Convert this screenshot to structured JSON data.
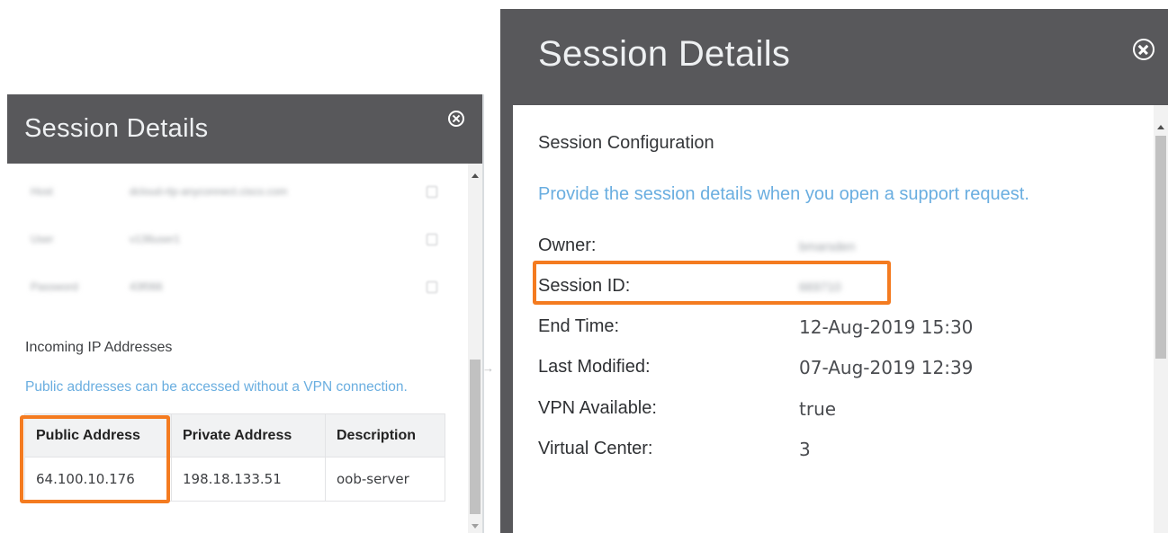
{
  "left_panel": {
    "title": "Session Details",
    "credentials": [
      {
        "label": "Host",
        "value": "dcloud-rtp-anyconnect.cisco.com"
      },
      {
        "label": "User",
        "value": "v136user1"
      },
      {
        "label": "Password",
        "value": "43f066"
      }
    ],
    "incoming_title": "Incoming IP Addresses",
    "incoming_description": "Public addresses can be accessed without a VPN connection.",
    "table": {
      "headers": [
        "Public Address",
        "Private Address",
        "Description"
      ],
      "rows": [
        [
          "64.100.10.176",
          "198.18.133.51",
          "oob-server"
        ]
      ]
    }
  },
  "right_panel": {
    "title": "Session Details",
    "section_title": "Session Configuration",
    "description": "Provide the session details when you open a support request.",
    "details": [
      {
        "label": "Owner:",
        "value": "bmarsden"
      },
      {
        "label": "Session ID:",
        "value": "669710"
      },
      {
        "label": "End Time:",
        "value": "12-Aug-2019 15:30"
      },
      {
        "label": "Last Modified:",
        "value": "07-Aug-2019 12:39"
      },
      {
        "label": "VPN Available:",
        "value": "true"
      },
      {
        "label": "Virtual Center:",
        "value": "3"
      }
    ]
  },
  "icons": {
    "close": "close-icon",
    "copy": "copy-icon"
  },
  "colors": {
    "header_bg": "#58585b",
    "link_blue": "#6aaee0",
    "highlight_orange": "#f47b20"
  }
}
